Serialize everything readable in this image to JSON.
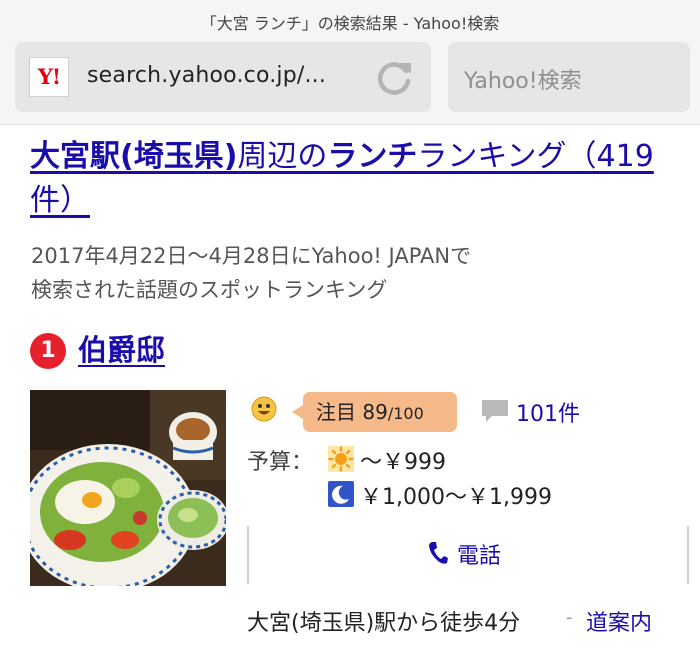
{
  "browser": {
    "page_title": "「大宮 ランチ」の検索結果 - Yahoo!検索",
    "logo_text": "Y!",
    "url": "search.yahoo.co.jp/...",
    "search_placeholder": "Yahoo!検索"
  },
  "content": {
    "headline": {
      "part1": "大宮駅(埼玉県)",
      "part2": "周辺の",
      "part3": "ランチ",
      "part4": "ランキング（419件）"
    },
    "subtitle_line1": "2017年4月22日〜4月28日にYahoo! JAPANで",
    "subtitle_line2": "検索された話題のスポットランキング",
    "rank_number": "1",
    "shop_name": "伯爵邸",
    "attention_label": "注目",
    "attention_score": "89",
    "attention_max": "/100",
    "comment_count": "101件",
    "budget_label": "予算：",
    "lunch_price": "〜￥999",
    "dinner_price": "￥1,000〜￥1,999",
    "phone_label": "電話",
    "access_text": "大宮(埼玉県)駅から徒歩4分",
    "access_separator": "-",
    "route_link": "道案内"
  },
  "icons": {
    "reload": "reload-icon",
    "smile": "smile-icon",
    "comment": "comment-icon",
    "sun": "sun-icon",
    "moon": "moon-icon",
    "phone": "phone-icon"
  },
  "colors": {
    "link": "#1a0dab",
    "rank_badge": "#e6202c",
    "attention_badge": "#f5b98a",
    "logo_red": "#e60012"
  }
}
